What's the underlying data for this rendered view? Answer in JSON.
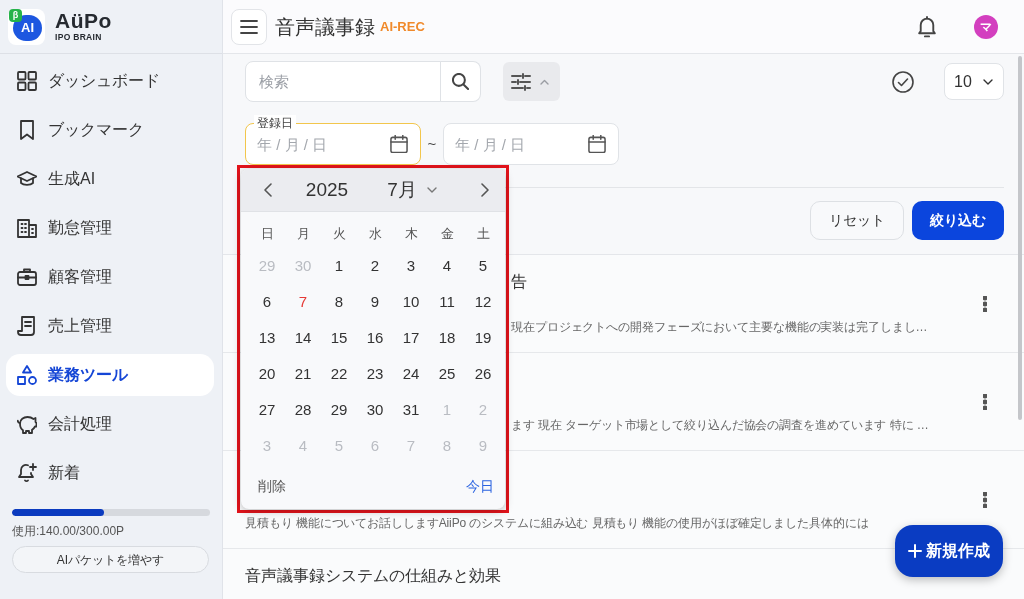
{
  "sidebar": {
    "logo": {
      "badge": "β",
      "mark": "AI",
      "brand": "AüPo",
      "tagline": "IPO BRAIN"
    },
    "items": [
      {
        "label": "ダッシュボード",
        "selected": false
      },
      {
        "label": "ブックマーク",
        "selected": false
      },
      {
        "label": "生成AI",
        "selected": false
      },
      {
        "label": "勤怠管理",
        "selected": false
      },
      {
        "label": "顧客管理",
        "selected": false
      },
      {
        "label": "売上管理",
        "selected": false
      },
      {
        "label": "業務ツール",
        "selected": true
      },
      {
        "label": "会計処理",
        "selected": false
      },
      {
        "label": "新着",
        "selected": false
      }
    ],
    "usage": {
      "level": 0.467,
      "text": "使用:140.00/300.00P"
    },
    "add_button": "AIパケットを増やす"
  },
  "header": {
    "title": "音声議事録",
    "tag": "AI-REC",
    "avatar": "マ"
  },
  "filters": {
    "search": {
      "placeholder": "検索"
    },
    "toggle": {
      "expanded": true
    },
    "page_size": "10",
    "date_from": {
      "label": "登録日",
      "placeholder": "年 / 月 / 日",
      "focused": true
    },
    "separator": "~",
    "date_to": {
      "placeholder": "年 / 月 / 日",
      "focused": false
    },
    "reset": "リセット",
    "apply": "絞り込む"
  },
  "calendar": {
    "highlighted": true,
    "year": "2025",
    "month": "7月",
    "weekdays": [
      "日",
      "月",
      "火",
      "水",
      "木",
      "金",
      "土"
    ],
    "weeks": [
      [
        {
          "day": "29",
          "outside": true,
          "today": false
        },
        {
          "day": "30",
          "outside": true,
          "today": false
        },
        {
          "day": "1",
          "outside": false,
          "today": false
        },
        {
          "day": "2",
          "outside": false,
          "today": false
        },
        {
          "day": "3",
          "outside": false,
          "today": false
        },
        {
          "day": "4",
          "outside": false,
          "today": false
        },
        {
          "day": "5",
          "outside": false,
          "today": false
        }
      ],
      [
        {
          "day": "6",
          "outside": false,
          "today": false
        },
        {
          "day": "7",
          "outside": false,
          "today": true
        },
        {
          "day": "8",
          "outside": false,
          "today": false
        },
        {
          "day": "9",
          "outside": false,
          "today": false
        },
        {
          "day": "10",
          "outside": false,
          "today": false
        },
        {
          "day": "11",
          "outside": false,
          "today": false
        },
        {
          "day": "12",
          "outside": false,
          "today": false
        }
      ],
      [
        {
          "day": "13",
          "outside": false,
          "today": false
        },
        {
          "day": "14",
          "outside": false,
          "today": false
        },
        {
          "day": "15",
          "outside": false,
          "today": false
        },
        {
          "day": "16",
          "outside": false,
          "today": false
        },
        {
          "day": "17",
          "outside": false,
          "today": false
        },
        {
          "day": "18",
          "outside": false,
          "today": false
        },
        {
          "day": "19",
          "outside": false,
          "today": false
        }
      ],
      [
        {
          "day": "20",
          "outside": false,
          "today": false
        },
        {
          "day": "21",
          "outside": false,
          "today": false
        },
        {
          "day": "22",
          "outside": false,
          "today": false
        },
        {
          "day": "23",
          "outside": false,
          "today": false
        },
        {
          "day": "24",
          "outside": false,
          "today": false
        },
        {
          "day": "25",
          "outside": false,
          "today": false
        },
        {
          "day": "26",
          "outside": false,
          "today": false
        }
      ],
      [
        {
          "day": "27",
          "outside": false,
          "today": false
        },
        {
          "day": "28",
          "outside": false,
          "today": false
        },
        {
          "day": "29",
          "outside": false,
          "today": false
        },
        {
          "day": "30",
          "outside": false,
          "today": false
        },
        {
          "day": "31",
          "outside": false,
          "today": false
        },
        {
          "day": "1",
          "outside": true,
          "today": false
        },
        {
          "day": "2",
          "outside": true,
          "today": false
        }
      ],
      [
        {
          "day": "3",
          "outside": true,
          "today": false
        },
        {
          "day": "4",
          "outside": true,
          "today": false
        },
        {
          "day": "5",
          "outside": true,
          "today": false
        },
        {
          "day": "6",
          "outside": true,
          "today": false
        },
        {
          "day": "7",
          "outside": true,
          "today": false
        },
        {
          "day": "8",
          "outside": true,
          "today": false
        },
        {
          "day": "9",
          "outside": true,
          "today": false
        }
      ]
    ],
    "clear": "削除",
    "today": "今日"
  },
  "records": [
    {
      "title": "告",
      "description": "現在プロジェクトへの開発フェーズにおいて主要な機能の実装は完了しまし…",
      "menu": true
    },
    {
      "description": "ます 現在 ターゲット市場として絞り込んだ協会の調査を進めています 特に …",
      "menu": true
    },
    {
      "description": "見積もり 機能についてお話ししますAiiPo のシステムに組み込む 見積もり 機能の使用がほぼ確定しました具体的には",
      "menu": true
    },
    {
      "title": "音声議事録システムの仕組みと効果",
      "menu": false
    }
  ],
  "fab": "新規作成"
}
